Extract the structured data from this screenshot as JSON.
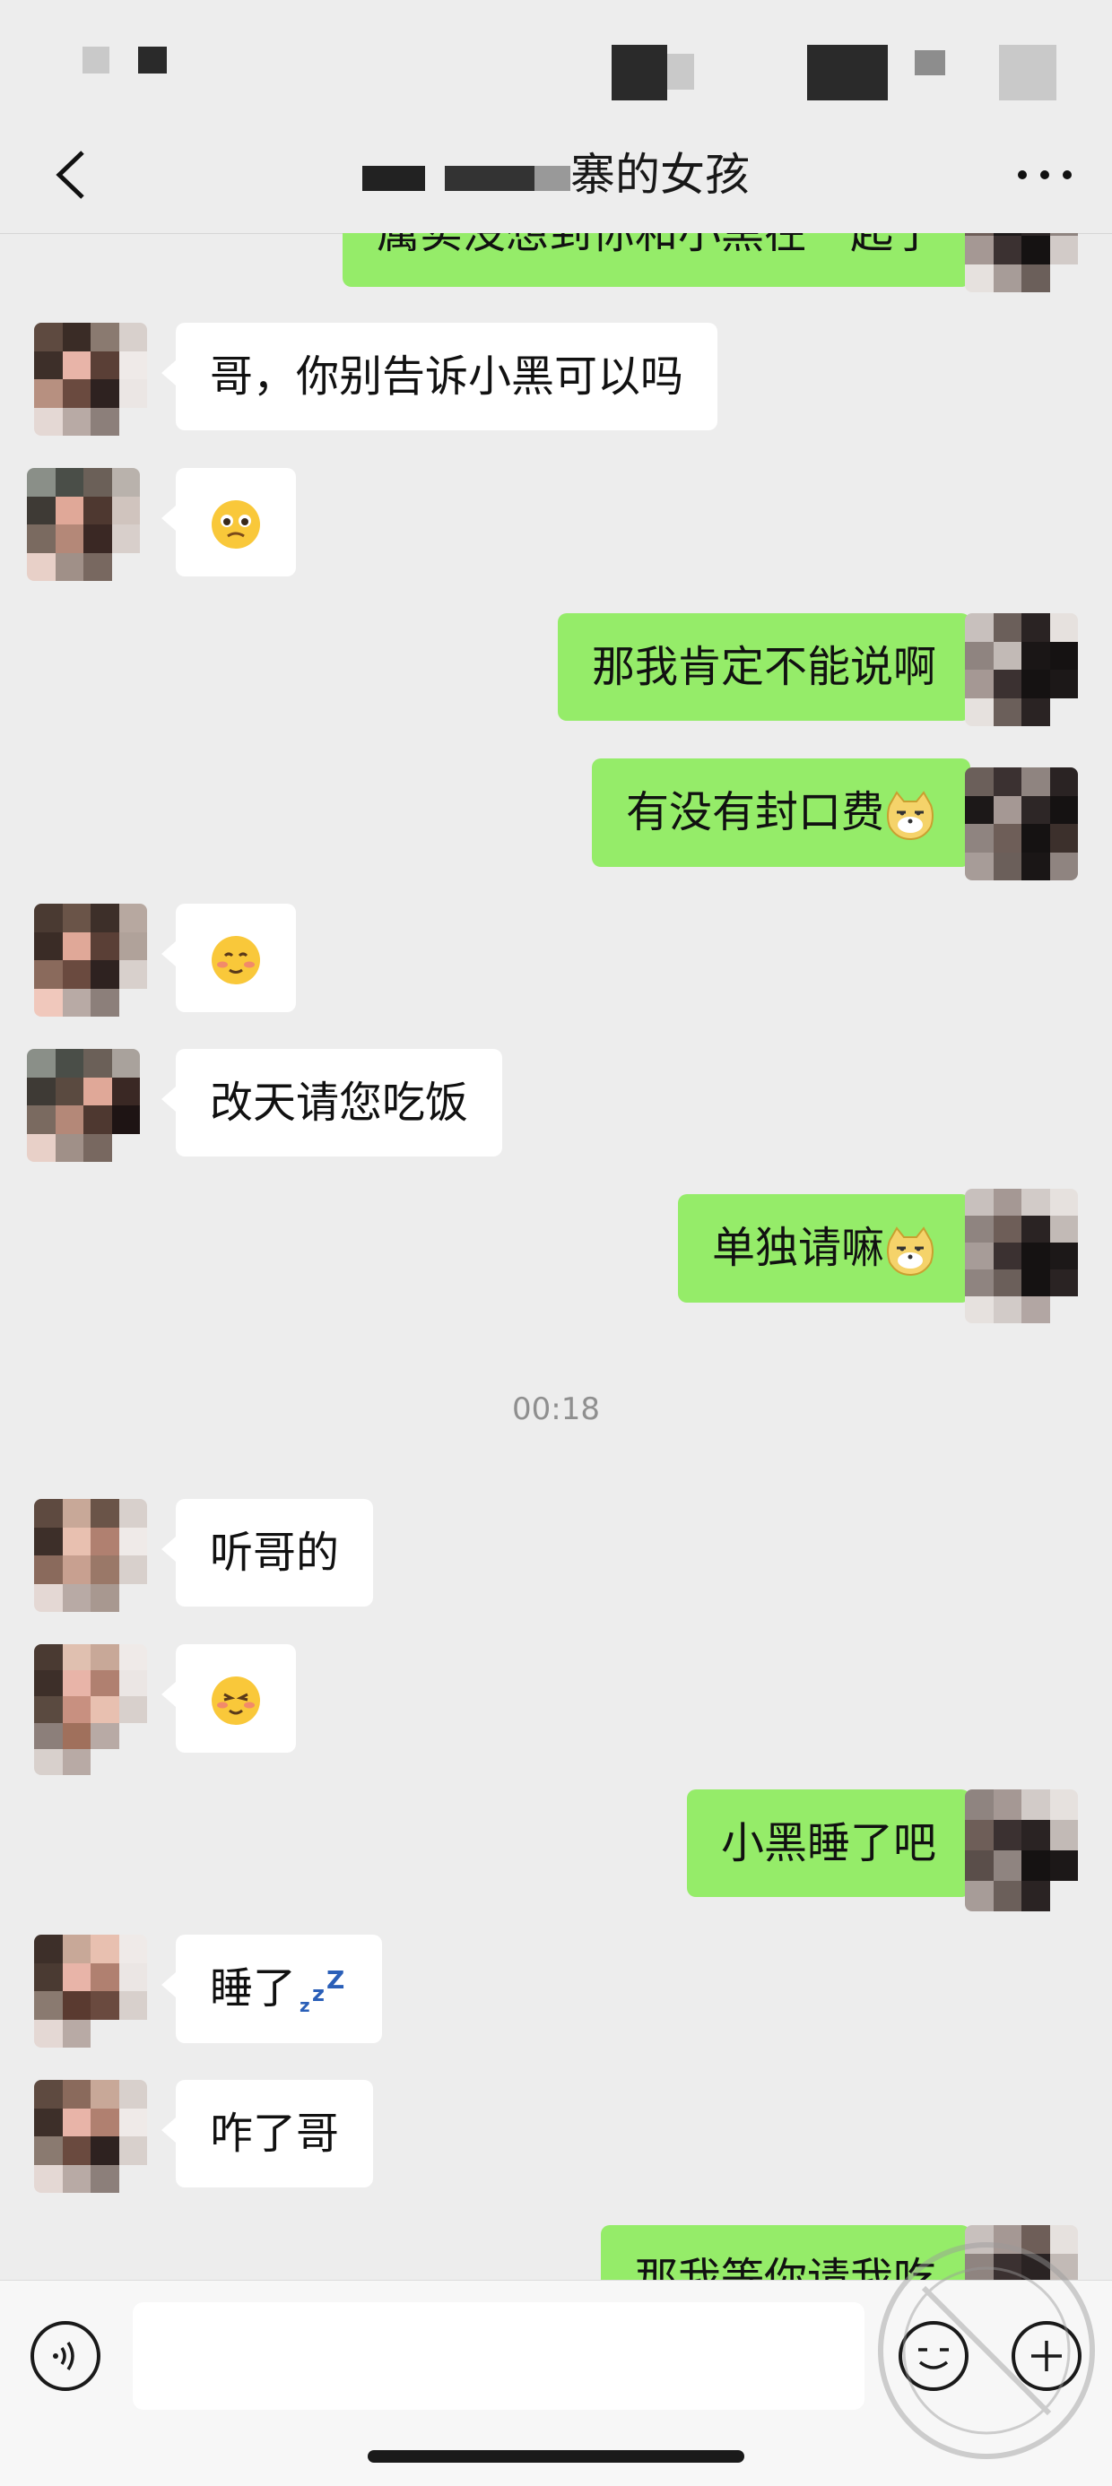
{
  "header": {
    "title_suffix": "寨的女孩"
  },
  "time_divider": "00:18",
  "messages": [
    {
      "side": "out",
      "text": "属实没想到你和小黑在一起了",
      "partial": true
    },
    {
      "side": "in",
      "text": "哥，你别告诉小黑可以吗"
    },
    {
      "side": "in",
      "emoji": "pleading-face-emoji"
    },
    {
      "side": "out",
      "text": "那我肯定不能说啊"
    },
    {
      "side": "out",
      "text": "有没有封口费",
      "emoji": "doge-cat-emoji"
    },
    {
      "side": "in",
      "emoji": "blushing-smile-emoji"
    },
    {
      "side": "in",
      "text": "改天请您吃饭"
    },
    {
      "side": "out",
      "text": "单独请嘛",
      "emoji": "doge-cat-emoji"
    },
    {
      "side": "in",
      "text": "听哥的"
    },
    {
      "side": "in",
      "emoji": "happy-closed-eyes-emoji"
    },
    {
      "side": "out",
      "text": "小黑睡了吧"
    },
    {
      "side": "in",
      "text": "睡了",
      "emoji": "zzz-emoji"
    },
    {
      "side": "in",
      "text": "咋了哥"
    },
    {
      "side": "out",
      "text": "那我等你请我吃",
      "partial": true
    }
  ],
  "icons": {
    "back": "chevron-left-icon",
    "more": "more-dots-icon",
    "voice": "voice-icon",
    "emoji": "emoji-icon",
    "plus": "plus-icon"
  },
  "colors": {
    "background": "#ededed",
    "outgoing_bubble": "#95ec69",
    "incoming_bubble": "#ffffff"
  }
}
